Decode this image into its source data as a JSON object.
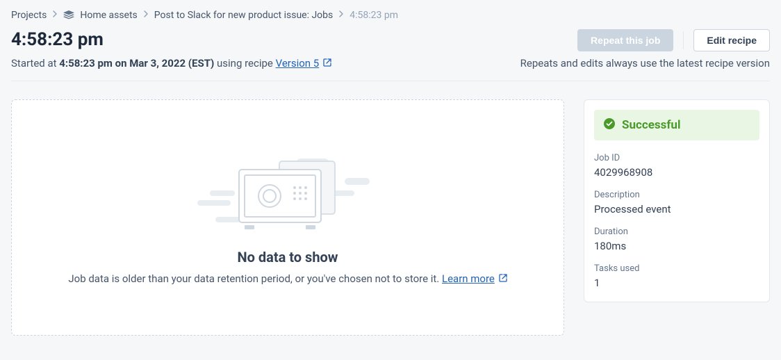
{
  "breadcrumb": {
    "projects": "Projects",
    "folder": "Home assets",
    "recipe": "Post to Slack for new product issue: Jobs",
    "current": "4:58:23 pm"
  },
  "header": {
    "title": "4:58:23 pm",
    "repeat_label": "Repeat this job",
    "edit_label": "Edit recipe"
  },
  "subheader": {
    "started_prefix": "Started at ",
    "started_time": "4:58:23 pm on Mar 3, 2022 (EST)",
    "using_recipe": " using recipe ",
    "version_label": "Version 5",
    "note": "Repeats and edits always use the latest recipe version"
  },
  "empty": {
    "title": "No data to show",
    "desc": "Job data is older than your data retention period, or you've chosen not to store it. ",
    "learn": "Learn more"
  },
  "side": {
    "status": "Successful",
    "job_id_label": "Job ID",
    "job_id": "4029968908",
    "description_label": "Description",
    "description": "Processed event",
    "duration_label": "Duration",
    "duration": "180ms",
    "tasks_label": "Tasks used",
    "tasks": "1"
  }
}
